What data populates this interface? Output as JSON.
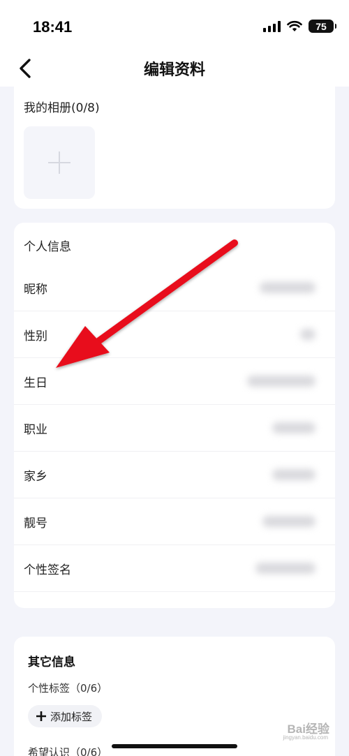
{
  "status_bar": {
    "time": "18:41",
    "battery": "75"
  },
  "nav": {
    "title": "编辑资料"
  },
  "album": {
    "title": "我的相册(0/8)"
  },
  "personal_info": {
    "title": "个人信息",
    "rows": [
      {
        "label": "昵称"
      },
      {
        "label": "性别"
      },
      {
        "label": "生日"
      },
      {
        "label": "职业"
      },
      {
        "label": "家乡"
      },
      {
        "label": "靓号"
      },
      {
        "label": "个性签名"
      }
    ]
  },
  "other_info": {
    "title": "其它信息",
    "tags_label": "个性标签（0/6）",
    "add_tag_label": "添加标签",
    "hope_label": "希望认识（0/6）"
  },
  "annotation": {
    "color": "#e8111a"
  },
  "watermark": {
    "text": "Bai经验",
    "sub": "jingyan.baidu.com"
  }
}
